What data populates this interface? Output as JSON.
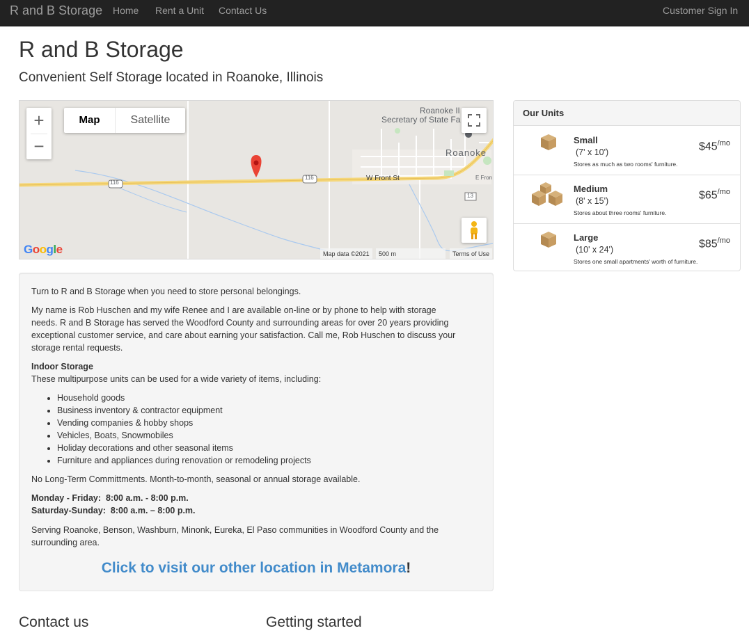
{
  "navbar": {
    "brand": "R and B Storage",
    "links": [
      "Home",
      "Rent a Unit",
      "Contact Us"
    ],
    "sign_in": "Customer Sign In"
  },
  "header": {
    "title": "R and B Storage",
    "subtitle": "Convenient Self Storage located in Roanoke, Illinois"
  },
  "map": {
    "zoom_in": "+",
    "zoom_out": "−",
    "type_map": "Map",
    "type_satellite": "Satellite",
    "labels": {
      "place1_line1": "Roanoke Il",
      "place1_line2": "Secretary of State Fa",
      "town": "Roanoke",
      "street": "W Front St",
      "street2": "E Fron",
      "route116a": "116",
      "route116b": "116",
      "route13": "13"
    },
    "google": "Google",
    "map_data": "Map data ©2021",
    "scale": "500 m",
    "terms": "Terms of Use"
  },
  "info": {
    "intro": "Turn to R and B Storage when you need to store personal belongings.",
    "about": "My name is Rob Huschen and my wife Renee and I are available on-line or by phone to help with storage needs. R and B Storage has served the Woodford County and surrounding areas for over 20 years providing exceptional customer service, and care about earning your satisfaction. Call me, Rob Huschen to discuss your storage rental requests.",
    "indoor_heading": "Indoor Storage",
    "indoor_text": "These multipurpose units can be used for a wide variety of items, including:",
    "uses": [
      "Household goods",
      "Business inventory & contractor equipment",
      "Vending companies & hobby shops",
      "Vehicles, Boats, Snowmobiles",
      "Holiday decorations and other seasonal items",
      "Furniture and appliances during renovation or remodeling projects"
    ],
    "terms": "No Long-Term Committments. Month-to-month, seasonal or annual storage available.",
    "hours1_label": "Monday - Friday:",
    "hours1_value": "8:00 a.m. - 8:00 p.m.",
    "hours2_label": "Saturday-Sunday:",
    "hours2_value": "8:00 a.m. – 8:00 p.m.",
    "serving": "Serving Roanoke, Benson, Washburn, Minonk, Eureka, El Paso communities in Woodford County and the surrounding area.",
    "visit_link": "Click to visit our other location in Metamora",
    "visit_suffix": "!"
  },
  "units": {
    "heading": "Our Units",
    "items": [
      {
        "name": "Small",
        "size": "(7' x 10')",
        "desc": "Stores as much as two rooms' furniture.",
        "price": "$45",
        "per": "/mo"
      },
      {
        "name": "Medium",
        "size": "(8' x 15')",
        "desc": "Stores about three rooms' furniture.",
        "price": "$65",
        "per": "/mo"
      },
      {
        "name": "Large",
        "size": "(10' x 24')",
        "desc": "Stores one small apartments' worth of furniture.",
        "price": "$85",
        "per": "/mo"
      }
    ]
  },
  "bottom": {
    "contact_heading": "Contact us",
    "started_heading": "Getting started"
  },
  "colors": {
    "navbar_bg": "#222222",
    "nav_text": "#9d9d9d",
    "link_blue": "#428bca",
    "well_bg": "#f5f5f5",
    "map_pin": "#ea4335",
    "highway": "#f5d77a"
  }
}
